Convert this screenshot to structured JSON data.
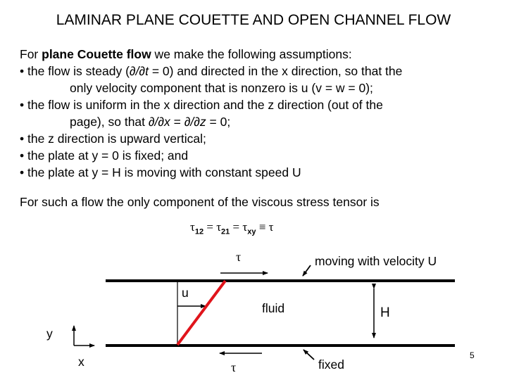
{
  "title": "LAMINAR PLANE COUETTE AND OPEN CHANNEL FLOW",
  "intro": {
    "prefix": "For ",
    "bold": "plane Couette flow",
    "suffix": " we make the following assumptions:"
  },
  "bullets": [
    {
      "line1_a": "• the flow is steady (",
      "line1_deriv": "∂/∂t",
      "line1_b": " = 0) and directed in the x direction, so that the",
      "line2": "only velocity component that is nonzero is u (v = w = 0);"
    },
    {
      "line1": "• the flow is uniform in the x direction and the z direction (out of the",
      "line2_a": "page), so that ",
      "line2_deriv1": "∂/∂x",
      "line2_mid": " = ",
      "line2_deriv2": "∂/∂z",
      "line2_b": " = 0;"
    },
    {
      "line1": "• the z direction is upward vertical;"
    },
    {
      "line1": "• the plate at y = 0 is fixed; and"
    },
    {
      "line1": "• the plate at y = H is moving with constant speed U"
    }
  ],
  "paragraph2": "For such a flow the only component of the viscous stress tensor is",
  "equation": {
    "t1": "τ",
    "s1": "12",
    "eq1": " = ",
    "t2": "τ",
    "s2": "21",
    "eq2": " = ",
    "t3": "τ",
    "s3": "xy",
    "eq3": " ≡ ",
    "t4": "τ"
  },
  "diagram": {
    "tau_top": "τ",
    "tau_bottom": "τ",
    "moving_label": "moving with velocity U",
    "u_label": "u",
    "fluid_label": "fluid",
    "height_label": "H",
    "y_axis_label": "y",
    "x_axis_label": "x",
    "fixed_label": "fixed",
    "profile_color": "#e0141b"
  },
  "page_number": "5"
}
